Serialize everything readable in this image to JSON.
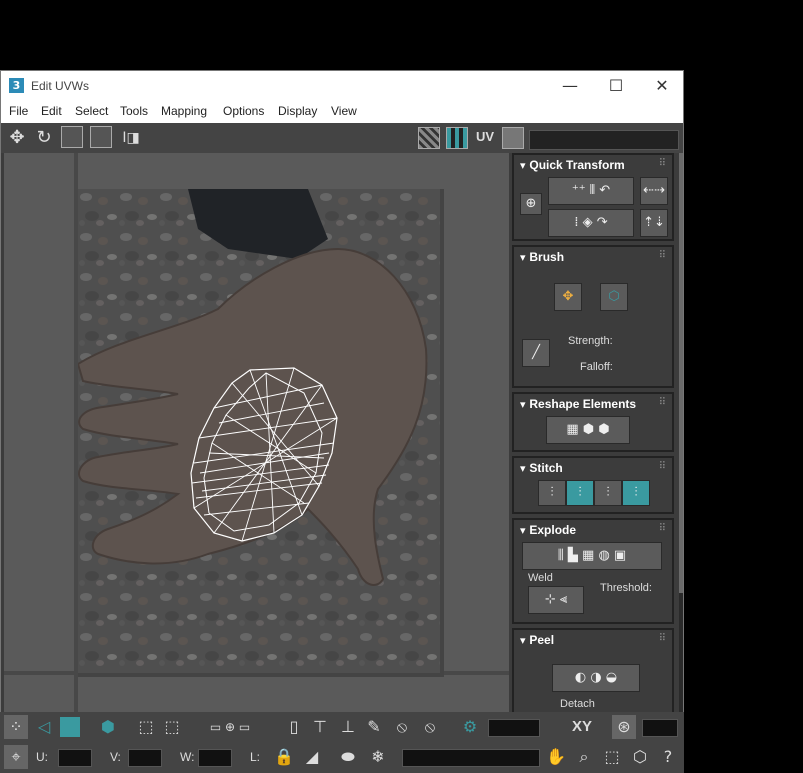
{
  "window": {
    "app_icon": "3",
    "title": "Edit UVWs",
    "minimize": "—",
    "maximize": "☐",
    "close": "✕"
  },
  "menu": [
    "File",
    "Edit",
    "Select",
    "Tools",
    "Mapping",
    "Options",
    "Display",
    "View"
  ],
  "toolbar": {
    "uv_label": "UV",
    "icons": [
      "move-icon",
      "rotate-icon",
      "scale-icon",
      "freeform-icon",
      "mirror-icon",
      "checker-icon",
      "checker-pattern-icon",
      "settings-icon"
    ]
  },
  "rollouts": {
    "quick_transform": {
      "title": "Quick Transform"
    },
    "brush": {
      "title": "Brush",
      "strength_label": "Strength:",
      "falloff_label": "Falloff:"
    },
    "reshape": {
      "title": "Reshape Elements"
    },
    "stitch": {
      "title": "Stitch"
    },
    "explode": {
      "title": "Explode",
      "weld_label": "Weld",
      "threshold_label": "Threshold:"
    },
    "peel": {
      "title": "Peel",
      "detach_label": "Detach"
    }
  },
  "bottom": {
    "xy_label": "XY",
    "u_label": "U:",
    "v_label": "V:",
    "w_label": "W:",
    "l_label": "L:"
  },
  "colors": {
    "accent_teal": "#3a9aa0",
    "panel_bg": "#3c3c3c",
    "wire": "#ffffff"
  }
}
